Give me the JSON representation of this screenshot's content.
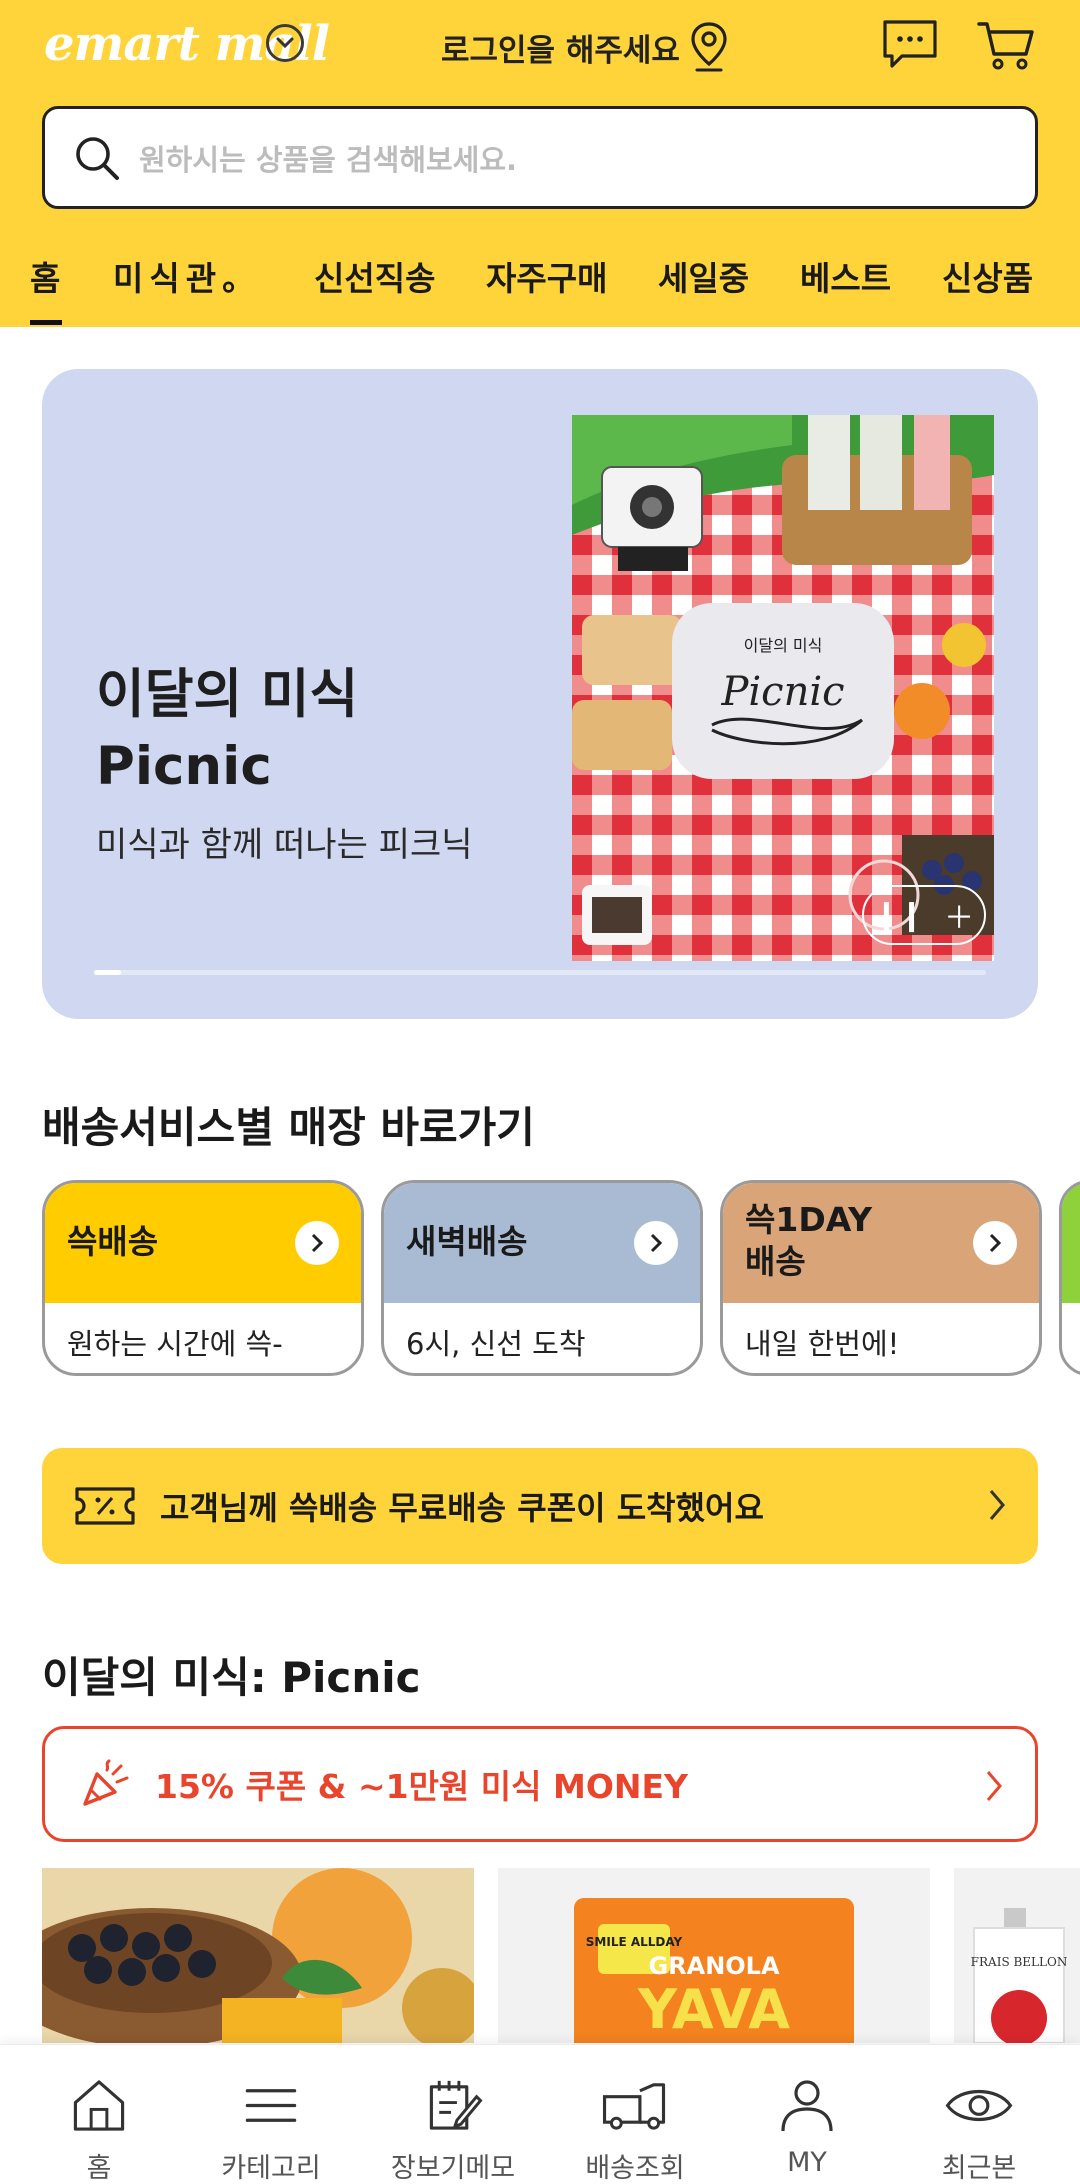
{
  "header": {
    "logo": "emart mall",
    "login_text": "로그인을 해주세요",
    "search_placeholder": "원하시는 상품을 검색해보세요."
  },
  "nav": {
    "tabs": [
      "홈",
      "미식관。",
      "신선직송",
      "자주구매",
      "세일중",
      "베스트",
      "신상품"
    ],
    "active_index": 0
  },
  "hero": {
    "title_line1": "이달의 미식",
    "title_line2": "Picnic",
    "subtitle": "미식과 함께 떠나는 피크닉",
    "image_badge_small": "이달의 미식",
    "image_badge_big": "Picnic",
    "progress": 0.03,
    "bg_color": "#d0d8f1"
  },
  "delivery": {
    "section_title": "배송서비스별 매장 바로가기",
    "cards": [
      {
        "title": "쓱배송",
        "desc": "원하는 시간에 쓱-",
        "color": "#ffcc00"
      },
      {
        "title": "새벽배송",
        "desc": "6시, 신선 도착",
        "color": "#a9bbd3"
      },
      {
        "title": "쓱1DAY\n배송",
        "title_line1": "쓱1DAY",
        "title_line2": "배송",
        "desc": "내일 한번에!",
        "color": "#d9a477"
      }
    ]
  },
  "coupon": {
    "text": "고객님께 쓱배송 무료배송 쿠폰이 도착했어요",
    "icon": "ticket-icon"
  },
  "picnic_section": {
    "title": "이달의 미식: Picnic",
    "promo_text": "15% 쿠폰 & ~1만원 미식 MONEY",
    "promo_color": "#e8452c",
    "products": [
      {
        "image": "blueberry-mango"
      },
      {
        "image": "granola-yava",
        "label": "GRANOLA",
        "brand": "YAVA",
        "tag": "SMILE ALLDAY"
      },
      {
        "image": "apple-pouch",
        "brand": "FRAIS BELLON"
      }
    ]
  },
  "bottom_nav": {
    "items": [
      {
        "label": "홈",
        "icon": "home-icon"
      },
      {
        "label": "카테고리",
        "icon": "menu-icon"
      },
      {
        "label": "장보기메모",
        "icon": "memo-icon"
      },
      {
        "label": "배송조회",
        "icon": "truck-icon"
      },
      {
        "label": "MY",
        "icon": "person-icon"
      },
      {
        "label": "최근본",
        "icon": "eye-icon"
      }
    ]
  },
  "colors": {
    "brand_yellow": "#ffd43b",
    "text_dark": "#1a1a1a"
  }
}
